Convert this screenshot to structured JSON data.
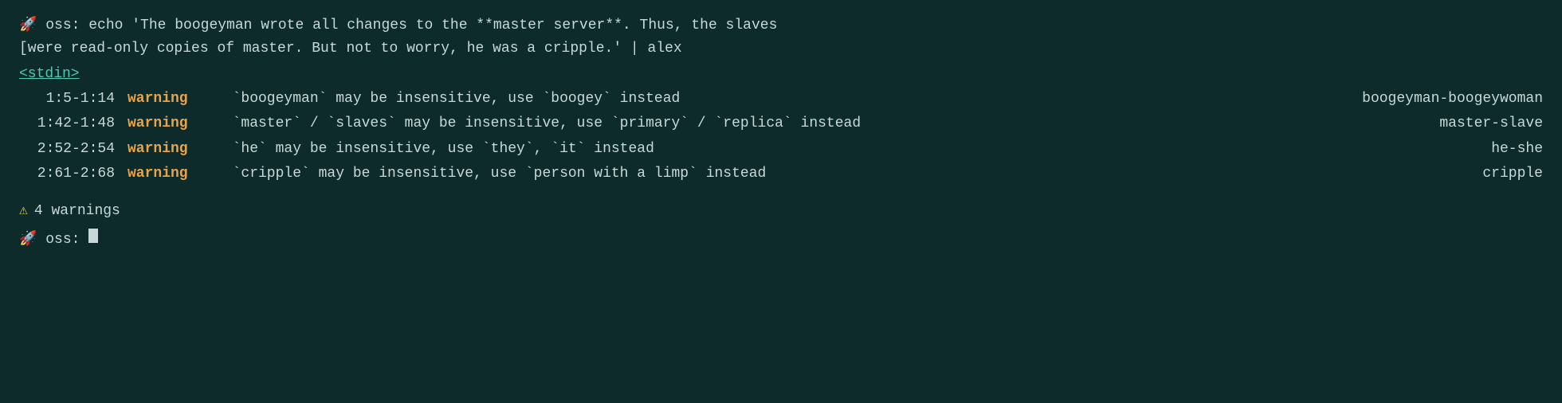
{
  "terminal": {
    "background": "#0d2b2b",
    "prompt_icon": "🚀",
    "line1": {
      "prefix": "oss: echo 'The boogeyman wrote all changes to the **master server**. Thus, the slaves"
    },
    "line2": {
      "text": "[were read-only copies of master. But not to worry, he was a cripple.' | alex"
    },
    "stdin_label": "<stdin>",
    "warnings": [
      {
        "position": "1:5-1:14",
        "level": "warning",
        "message": "`boogeyman` may be insensitive, use `boogey` instead",
        "rule": "boogeyman-boogeywoman"
      },
      {
        "position": "1:42-1:48",
        "level": "warning",
        "message": "`master` / `slaves` may be insensitive, use `primary` / `replica` instead",
        "rule": "master-slave"
      },
      {
        "position": "2:52-2:54",
        "level": "warning",
        "message": "`he` may be insensitive, use `they`, `it` instead",
        "rule": "he-she"
      },
      {
        "position": "2:61-2:68",
        "level": "warning",
        "message": "`cripple` may be insensitive, use `person with a limp` instead",
        "rule": "cripple"
      }
    ],
    "summary": {
      "icon": "⚠",
      "text": "4 warnings"
    },
    "final_prompt": "oss: _"
  }
}
